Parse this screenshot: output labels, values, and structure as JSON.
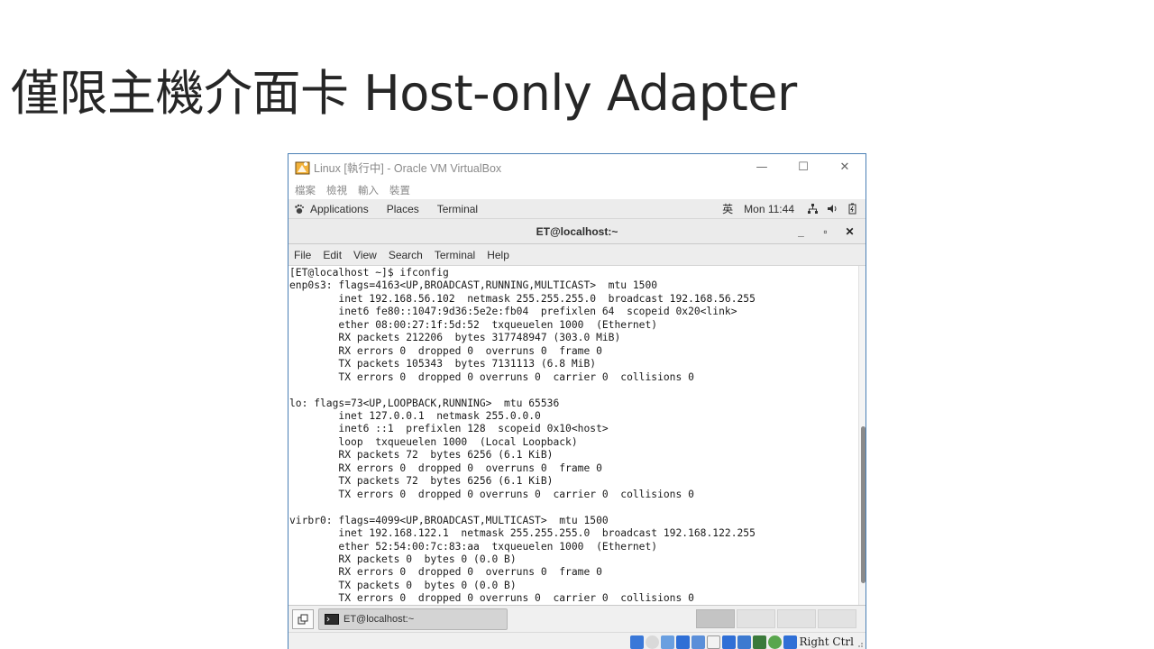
{
  "slide": {
    "title": "僅限主機介面卡 Host-only Adapter"
  },
  "virtualbox": {
    "window_title": "Linux [執行中] - Oracle VM VirtualBox",
    "menu": [
      "檔案",
      "檢視",
      "輸入",
      "裝置"
    ],
    "window_controls": {
      "minimize": "—",
      "maximize": "☐",
      "close": "✕"
    },
    "status": {
      "host_key": "Right Ctrl"
    }
  },
  "gnome": {
    "applications": "Applications",
    "places": "Places",
    "terminal": "Terminal",
    "input_method": "英",
    "clock": "Mon 11:44"
  },
  "terminal": {
    "title": "ET@localhost:~",
    "controls": {
      "minimize": "_",
      "maximize": "▫",
      "close": "✕"
    },
    "menu": [
      "File",
      "Edit",
      "View",
      "Search",
      "Terminal",
      "Help"
    ],
    "output": "[ET@localhost ~]$ ifconfig\nenp0s3: flags=4163<UP,BROADCAST,RUNNING,MULTICAST>  mtu 1500\n        inet 192.168.56.102  netmask 255.255.255.0  broadcast 192.168.56.255\n        inet6 fe80::1047:9d36:5e2e:fb04  prefixlen 64  scopeid 0x20<link>\n        ether 08:00:27:1f:5d:52  txqueuelen 1000  (Ethernet)\n        RX packets 212206  bytes 317748947 (303.0 MiB)\n        RX errors 0  dropped 0  overruns 0  frame 0\n        TX packets 105343  bytes 7131113 (6.8 MiB)\n        TX errors 0  dropped 0 overruns 0  carrier 0  collisions 0\n\nlo: flags=73<UP,LOOPBACK,RUNNING>  mtu 65536\n        inet 127.0.0.1  netmask 255.0.0.0\n        inet6 ::1  prefixlen 128  scopeid 0x10<host>\n        loop  txqueuelen 1000  (Local Loopback)\n        RX packets 72  bytes 6256 (6.1 KiB)\n        RX errors 0  dropped 0  overruns 0  frame 0\n        TX packets 72  bytes 6256 (6.1 KiB)\n        TX errors 0  dropped 0 overruns 0  carrier 0  collisions 0\n\nvirbr0: flags=4099<UP,BROADCAST,MULTICAST>  mtu 1500\n        inet 192.168.122.1  netmask 255.255.255.0  broadcast 192.168.122.255\n        ether 52:54:00:7c:83:aa  txqueuelen 1000  (Ethernet)\n        RX packets 0  bytes 0 (0.0 B)\n        RX errors 0  dropped 0  overruns 0  frame 0\n        TX packets 0  bytes 0 (0.0 B)\n        TX errors 0  dropped 0 overruns 0  carrier 0  collisions 0"
  },
  "taskbar": {
    "task_label": "ET@localhost:~",
    "workspaces_count": 4,
    "active_workspace": 1
  },
  "icons": {
    "vbox_logo": "virtualbox-logo-icon",
    "apps_menu": "gnome-foot-icon",
    "network": "network-icon",
    "volume": "volume-icon",
    "battery": "battery-icon",
    "terminal_task": "terminal-icon",
    "show_desktop": "show-desktop-icon"
  },
  "colors": {
    "window_border": "#4a7fb5",
    "taskbar_active": "#d4d4d4",
    "status_blue": "#2f6fd6"
  }
}
